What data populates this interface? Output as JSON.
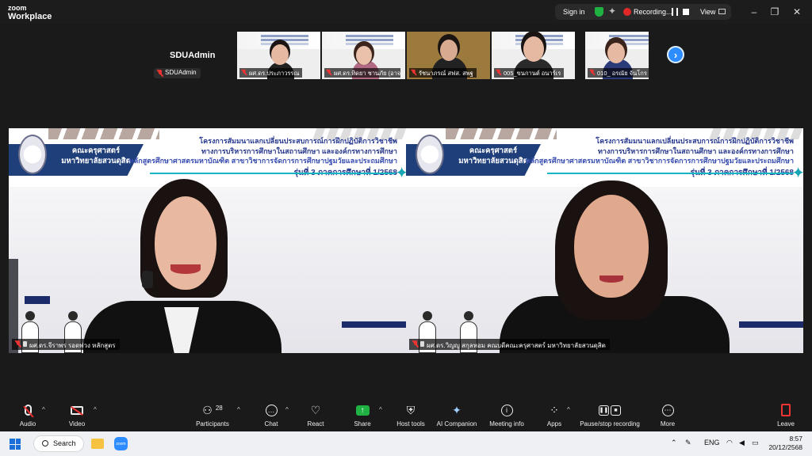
{
  "app": {
    "brand_line1": "zoom",
    "brand_line2": "Workplace"
  },
  "titlebar": {
    "sign_in": "Sign in",
    "recording": "Recording...",
    "view": "View"
  },
  "window_controls": [
    "–",
    "❐",
    "✕"
  ],
  "gallery": {
    "self_name": "SDUAdmin",
    "self_tag": "SDUAdmin",
    "thumbnails": [
      {
        "label": "ผศ.ดร.ประภาวรรณ"
      },
      {
        "label": "ผศ.ดร.ทิดยา ชานภัย (อาจ..."
      },
      {
        "label": "รัชนาภรณ์ สฟส. สพฐ"
      },
      {
        "label": "005_ขนกานต์ อนาร์เร"
      },
      {
        "label": "010_ อรณัย จันโกร"
      }
    ],
    "next_label": "›"
  },
  "slide": {
    "faculty_line1": "คณะครุศาสตร์",
    "faculty_line2": "มหาวิทยาลัยสวนดุสิต",
    "title_line1": "โครงการสัมมนาแลกเปลี่ยนประสบการณ์การฝึกปฏิบัติการวิชาชีพ",
    "title_line2": "ทางการบริหารการศึกษาในสถานศึกษา และองค์กรทางการศึกษา",
    "title_line3": "หลักสูตรศึกษาศาสตรมหาบัณฑิต สาขาวิชาการจัดการการศึกษาปฐมวัยและประถมศึกษา",
    "title_line4": "รุ่นที่ 3  ภาคการศึกษาที่ 1/2568"
  },
  "videos": [
    {
      "name": "ผศ.ดร.จีราพร รอดพ่วง หลักสูตร"
    },
    {
      "name": "ผศ.ดร.วิญญู สกุลหอม คณบดีคณะครุศาสตร์ มหาวิทยาลัยสวนดุสิต"
    }
  ],
  "toolbar": {
    "audio": "Audio",
    "video": "Video",
    "participants": "Participants",
    "participants_count": "28",
    "chat": "Chat",
    "react": "React",
    "share": "Share",
    "host_tools": "Host tools",
    "ai_companion": "AI Companion",
    "meeting_info": "Meeting info",
    "apps": "Apps",
    "pause_stop": "Pause/stop recording",
    "more": "More",
    "leave": "Leave"
  },
  "taskbar": {
    "search": "Search",
    "zoom_app": "zoom",
    "lang": "ENG",
    "time": "8:57",
    "date": "20/12/2568"
  },
  "colors": {
    "accent": "#2d8cff",
    "slide_navy": "#1f3f7a",
    "slide_title": "#2a3b8f",
    "recording": "#e02828",
    "share_green": "#1fb141"
  }
}
